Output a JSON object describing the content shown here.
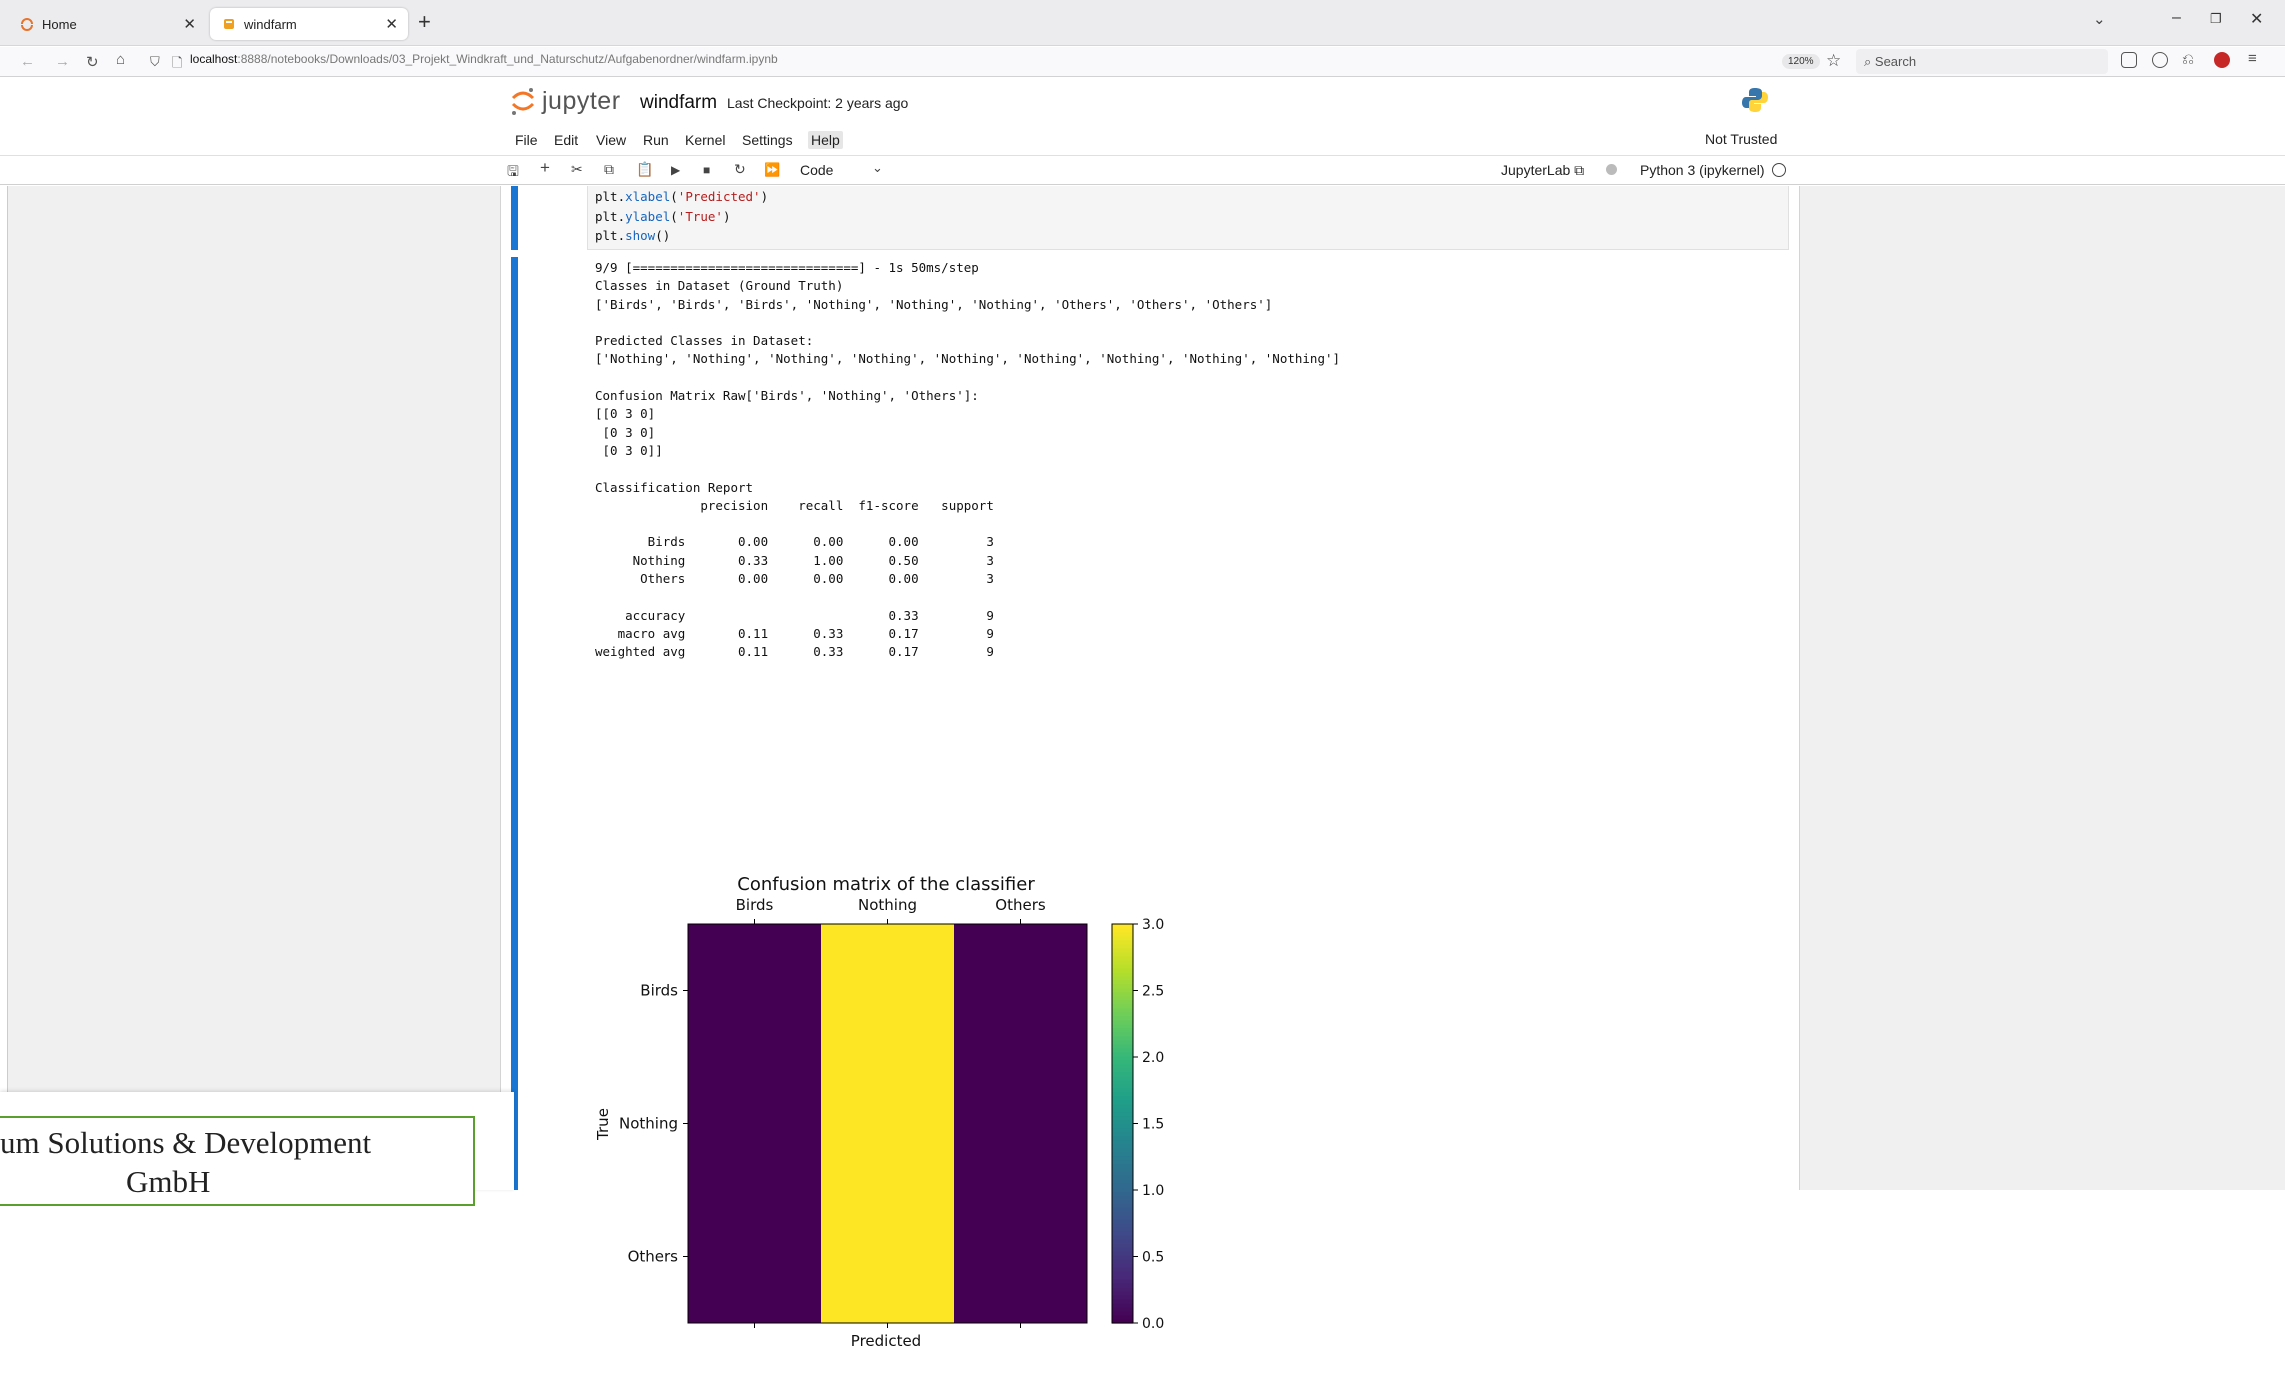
{
  "browser": {
    "tabs": [
      {
        "title": "Home",
        "active": false
      },
      {
        "title": "windfarm",
        "active": true
      }
    ],
    "new_tab": "+",
    "url_host": "localhost",
    "url_rest": ":8888/notebooks/Downloads/03_Projekt_Windkraft_und_Naturschutz/Aufgabenordner/windfarm.ipynb",
    "zoom": "120%",
    "search_placeholder": "Search"
  },
  "jupyter": {
    "logo_text": "jupyter",
    "notebook_name": "windfarm",
    "checkpoint": "Last Checkpoint: 2 years ago",
    "menus": [
      "File",
      "Edit",
      "View",
      "Run",
      "Kernel",
      "Settings",
      "Help"
    ],
    "active_menu": "Help",
    "trust_status": "Not Trusted",
    "cell_type": "Code",
    "jupyterlab_link": "JupyterLab",
    "kernel": "Python 3 (ipykernel)"
  },
  "cell1": {
    "code_lines": [
      {
        "pre": "plt.",
        "fn": "xlabel",
        "open": "(",
        "str": "'Predicted'",
        "close": ")"
      },
      {
        "pre": "plt.",
        "fn": "ylabel",
        "open": "(",
        "str": "'True'",
        "close": ")"
      },
      {
        "pre": "plt.",
        "fn": "show",
        "open": "()",
        "str": "",
        "close": ""
      }
    ]
  },
  "output": {
    "text": "9/9 [==============================] - 1s 50ms/step\nClasses in Dataset (Ground Truth)\n['Birds', 'Birds', 'Birds', 'Nothing', 'Nothing', 'Nothing', 'Others', 'Others', 'Others']\n\nPredicted Classes in Dataset:\n['Nothing', 'Nothing', 'Nothing', 'Nothing', 'Nothing', 'Nothing', 'Nothing', 'Nothing', 'Nothing']\n\nConfusion Matrix Raw['Birds', 'Nothing', 'Others']:\n[[0 3 0]\n [0 3 0]\n [0 3 0]]\n\nClassification Report\n              precision    recall  f1-score   support\n\n       Birds       0.00      0.00      0.00         3\n     Nothing       0.33      1.00      0.50         3\n      Others       0.00      0.00      0.00         3\n\n    accuracy                           0.33         9\n   macro avg       0.11      0.33      0.17         9\nweighted avg       0.11      0.33      0.17         9"
  },
  "chart_data": {
    "type": "heatmap",
    "title": "Confusion matrix of the classifier",
    "x_categories": [
      "Birds",
      "Nothing",
      "Others"
    ],
    "y_categories": [
      "Birds",
      "Nothing",
      "Others"
    ],
    "values": [
      [
        0,
        3,
        0
      ],
      [
        0,
        3,
        0
      ],
      [
        0,
        3,
        0
      ]
    ],
    "xlabel": "Predicted",
    "ylabel": "True",
    "colormap": "viridis",
    "colorbar_range": [
      0.0,
      3.0
    ],
    "colorbar_ticks": [
      "0.0",
      "0.5",
      "1.0",
      "1.5",
      "2.0",
      "2.5",
      "3.0"
    ],
    "colors": {
      "low": "#440154",
      "high": "#fde725"
    }
  },
  "overlay": {
    "line1": "um Solutions & Development",
    "line2": "GmbH"
  }
}
